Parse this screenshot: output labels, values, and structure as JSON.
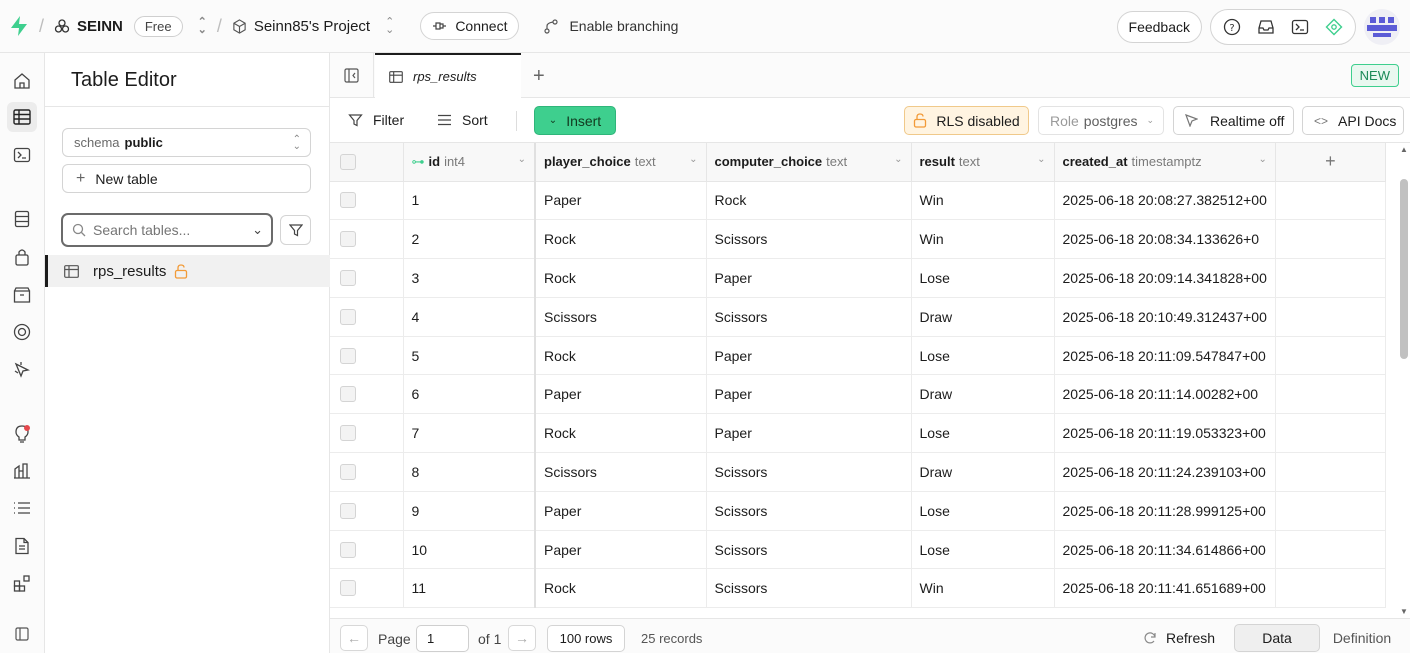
{
  "topbar": {
    "org_name": "SEINN",
    "plan_badge": "Free",
    "project_name": "Seinn85's Project",
    "connect_label": "Connect",
    "branching_label": "Enable branching",
    "feedback_label": "Feedback"
  },
  "sidepanel": {
    "title": "Table Editor",
    "schema_label": "schema",
    "schema_value": "public",
    "new_table_label": "New table",
    "search_placeholder": "Search tables...",
    "tables": [
      {
        "name": "rps_results",
        "rls_locked": true
      }
    ]
  },
  "tabs": {
    "active_tab": "rps_results",
    "new_badge": "NEW"
  },
  "toolbar": {
    "filter_label": "Filter",
    "sort_label": "Sort",
    "insert_label": "Insert",
    "rls_label": "RLS disabled",
    "role_label": "Role",
    "role_value": "postgres",
    "realtime_label": "Realtime off",
    "api_docs_label": "API Docs"
  },
  "grid": {
    "columns": [
      {
        "name": "id",
        "type": "int4",
        "key": true
      },
      {
        "name": "player_choice",
        "type": "text"
      },
      {
        "name": "computer_choice",
        "type": "text"
      },
      {
        "name": "result",
        "type": "text"
      },
      {
        "name": "created_at",
        "type": "timestamptz"
      }
    ],
    "rows": [
      [
        "1",
        "Paper",
        "Rock",
        "Win",
        "2025-06-18 20:08:27.382512+00"
      ],
      [
        "2",
        "Rock",
        "Scissors",
        "Win",
        "2025-06-18 20:08:34.133626+0"
      ],
      [
        "3",
        "Rock",
        "Paper",
        "Lose",
        "2025-06-18 20:09:14.341828+00"
      ],
      [
        "4",
        "Scissors",
        "Scissors",
        "Draw",
        "2025-06-18 20:10:49.312437+00"
      ],
      [
        "5",
        "Rock",
        "Paper",
        "Lose",
        "2025-06-18 20:11:09.547847+00"
      ],
      [
        "6",
        "Paper",
        "Paper",
        "Draw",
        "2025-06-18 20:11:14.00282+00"
      ],
      [
        "7",
        "Rock",
        "Paper",
        "Lose",
        "2025-06-18 20:11:19.053323+00"
      ],
      [
        "8",
        "Scissors",
        "Scissors",
        "Draw",
        "2025-06-18 20:11:24.239103+00"
      ],
      [
        "9",
        "Paper",
        "Scissors",
        "Lose",
        "2025-06-18 20:11:28.999125+00"
      ],
      [
        "10",
        "Paper",
        "Scissors",
        "Lose",
        "2025-06-18 20:11:34.614866+00"
      ],
      [
        "11",
        "Rock",
        "Scissors",
        "Win",
        "2025-06-18 20:11:41.651689+00"
      ]
    ]
  },
  "footer": {
    "page_label": "Page",
    "page_value": "1",
    "of_label": "of 1",
    "rows_label": "100 rows",
    "records_label": "25 records",
    "refresh_label": "Refresh",
    "data_label": "Data",
    "definition_label": "Definition"
  },
  "colors": {
    "brand": "#3ecf8e",
    "rls_warning_bg": "#fff4e1",
    "lock_orange": "#f29b38",
    "notification_red": "#e5484d"
  }
}
